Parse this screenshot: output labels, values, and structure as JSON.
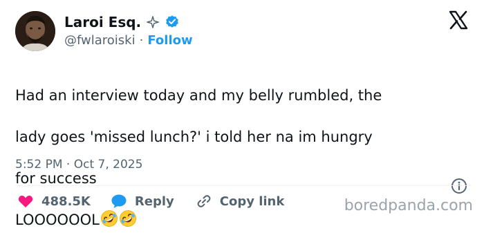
{
  "author": {
    "name": "Laroi Esq.",
    "handle": "@fwlaroiski",
    "separator": "·",
    "follow_label": "Follow",
    "verified_color": "#1d9bf0"
  },
  "tweet": {
    "line1": "Had an interview today and my belly rumbled, the",
    "line2": "lady goes 'missed lunch?' i told her na im hungry",
    "line3": "for success",
    "line4": "LOOOOOOL",
    "emojis": [
      "rolling-on-floor-laughing",
      "rolling-on-floor-laughing"
    ]
  },
  "meta": {
    "time": "5:52 PM",
    "separator": "·",
    "date": "Oct 7, 2025"
  },
  "actions": {
    "likes": "488.5K",
    "reply_label": "Reply",
    "copy_link_label": "Copy link"
  },
  "icons": {
    "sparkle": "sparkle-icon",
    "verified": "verified-badge-icon",
    "x_logo": "x-logo-icon",
    "info": "info-icon",
    "like": "heart-icon",
    "reply": "speech-bubble-icon",
    "link": "link-icon"
  },
  "colors": {
    "like": "#f91880",
    "reply": "#1d9bf0",
    "accent": "#1d9bf0",
    "text": "#0f1419",
    "muted": "#536471"
  },
  "watermark": "boredpanda.com"
}
